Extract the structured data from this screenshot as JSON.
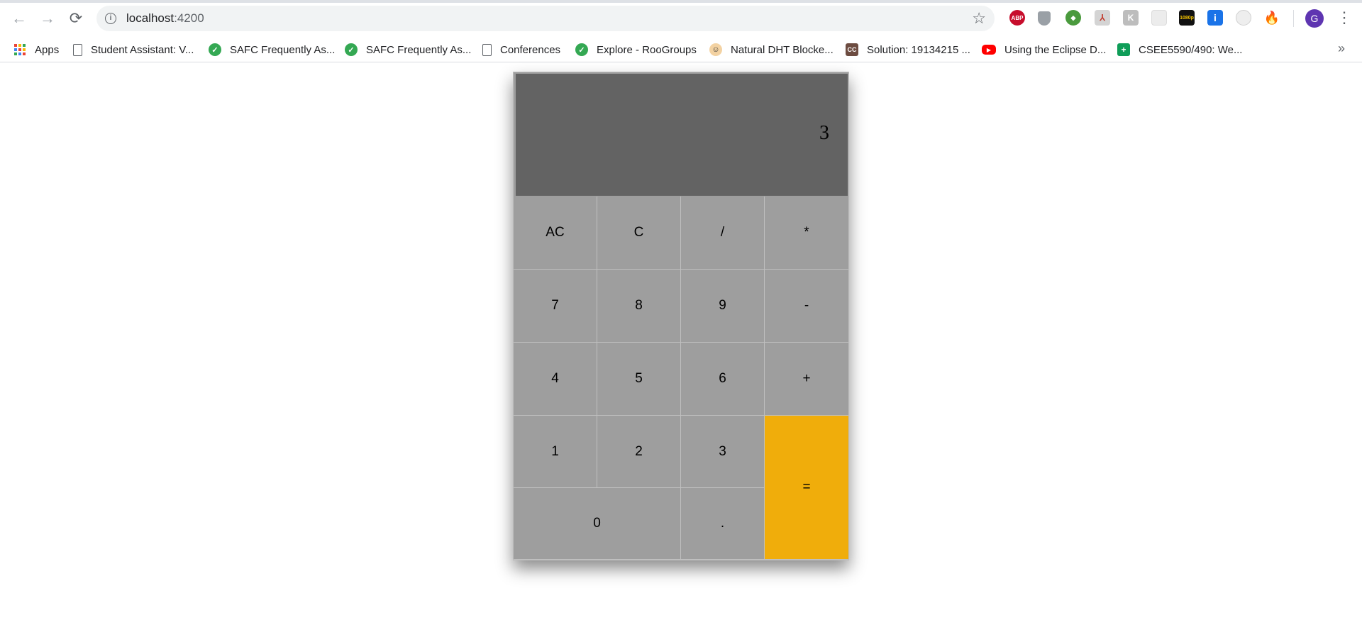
{
  "browser": {
    "url_host": "localhost",
    "url_port": ":4200",
    "nav": {
      "back_icon": "←",
      "forward_icon": "→",
      "reload_icon": "⟳"
    },
    "extensions": [
      {
        "name": "adblock-plus",
        "glyph": "ABP"
      },
      {
        "name": "shield",
        "glyph": ""
      },
      {
        "name": "globe",
        "glyph": "◆"
      },
      {
        "name": "pdf",
        "glyph": "⅄"
      },
      {
        "name": "k-extension",
        "glyph": "K"
      },
      {
        "name": "blank",
        "glyph": ""
      },
      {
        "name": "video-1080p",
        "glyph": "1080p"
      },
      {
        "name": "info",
        "glyph": "i"
      },
      {
        "name": "circle",
        "glyph": ""
      },
      {
        "name": "fire",
        "glyph": "🔥"
      }
    ],
    "avatar_letter": "G"
  },
  "bookmarks": [
    {
      "label": "Apps",
      "icon": "apps-grid-icon"
    },
    {
      "label": "Student Assistant: V...",
      "icon": "page-icon"
    },
    {
      "label": "SAFC Frequently As...",
      "icon": "vee-icon"
    },
    {
      "label": "SAFC Frequently As...",
      "icon": "vee-icon"
    },
    {
      "label": "Conferences",
      "icon": "page-icon"
    },
    {
      "label": "Explore - RooGroups",
      "icon": "vee-icon"
    },
    {
      "label": "Natural DHT Blocke...",
      "icon": "face-icon"
    },
    {
      "label": "Solution: 19134215 ...",
      "icon": "cc-icon"
    },
    {
      "label": "Using the Eclipse D...",
      "icon": "youtube-icon"
    },
    {
      "label": "CSEE5590/490: We...",
      "icon": "sheets-icon"
    }
  ],
  "bookmarks_more": "»",
  "calculator": {
    "display": "3",
    "keys": {
      "ac": "AC",
      "c": "C",
      "divide": "/",
      "multiply": "*",
      "seven": "7",
      "eight": "8",
      "nine": "9",
      "minus": "-",
      "four": "4",
      "five": "5",
      "six": "6",
      "plus": "+",
      "one": "1",
      "two": "2",
      "three": "3",
      "equals": "=",
      "zero": "0",
      "dot": "."
    }
  },
  "colors": {
    "display_bg": "#636363",
    "key_bg": "#9e9e9e",
    "equals_bg": "#f0ad0b"
  }
}
